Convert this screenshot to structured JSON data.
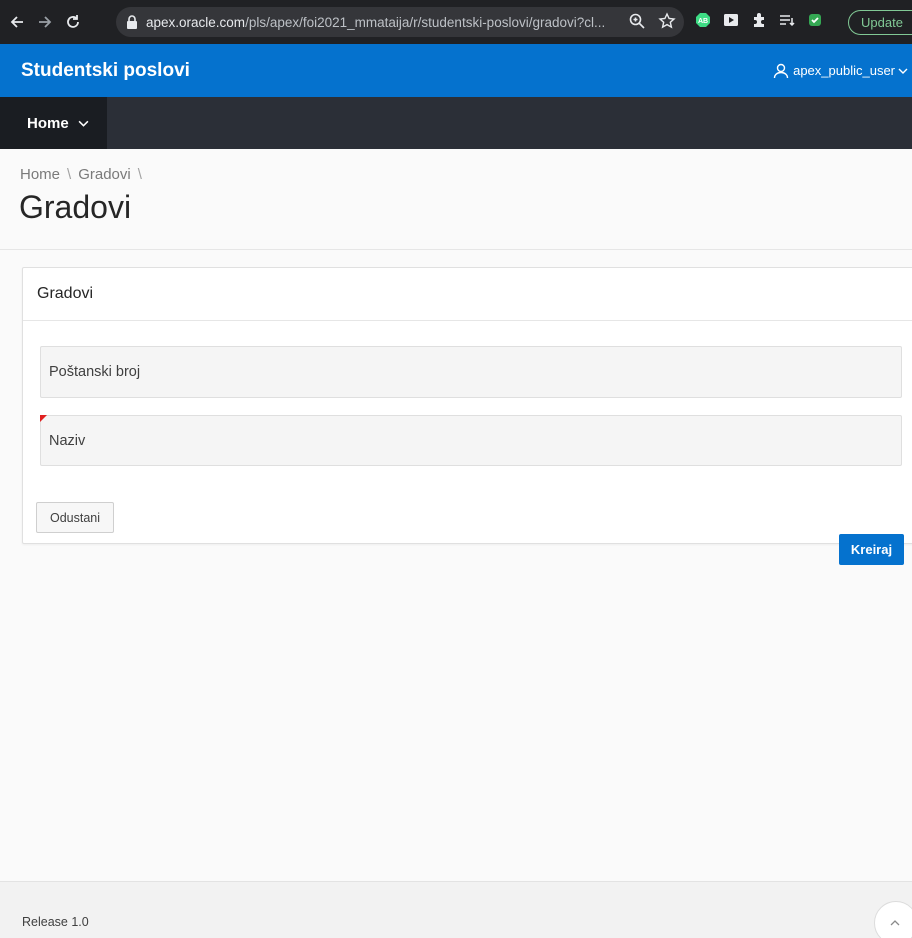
{
  "browser": {
    "url_host": "apex.oracle.com",
    "url_path": "/pls/apex/foi2021_mmataija/r/studentski-poslovi/gradovi?cl...",
    "update_label": "Update"
  },
  "app": {
    "title": "Studentski poslovi",
    "user": "apex_public_user"
  },
  "nav": {
    "home_label": "Home"
  },
  "breadcrumb": {
    "items": [
      "Home",
      "Gradovi"
    ]
  },
  "page": {
    "title": "Gradovi"
  },
  "region": {
    "title": "Gradovi",
    "fields": [
      {
        "label": "Poštanski broj",
        "required": false
      },
      {
        "label": "Naziv",
        "required": true
      }
    ],
    "cancel_label": "Odustani",
    "create_label": "Kreiraj"
  },
  "footer": {
    "release": "Release 1.0"
  },
  "colors": {
    "header_blue": "#0572ce",
    "nav_dark": "#2b2f37",
    "required_red": "#e02020"
  }
}
